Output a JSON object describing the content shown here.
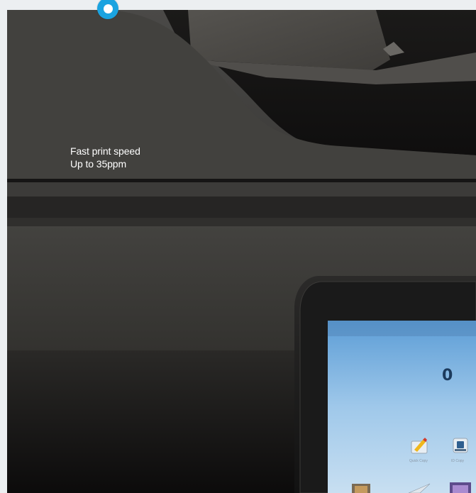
{
  "hotspot": {
    "icon": "hotspot-marker-icon",
    "accent_color": "#1aa3e0"
  },
  "caption": {
    "line1": "Fast print speed",
    "line2": "Up to 35ppm"
  },
  "device_screen": {
    "partial_time_text": "0",
    "apps": [
      {
        "icon": "edit-document-icon",
        "label": "Quick Copy"
      },
      {
        "icon": "id-copy-icon",
        "label": "ID Copy"
      }
    ]
  }
}
